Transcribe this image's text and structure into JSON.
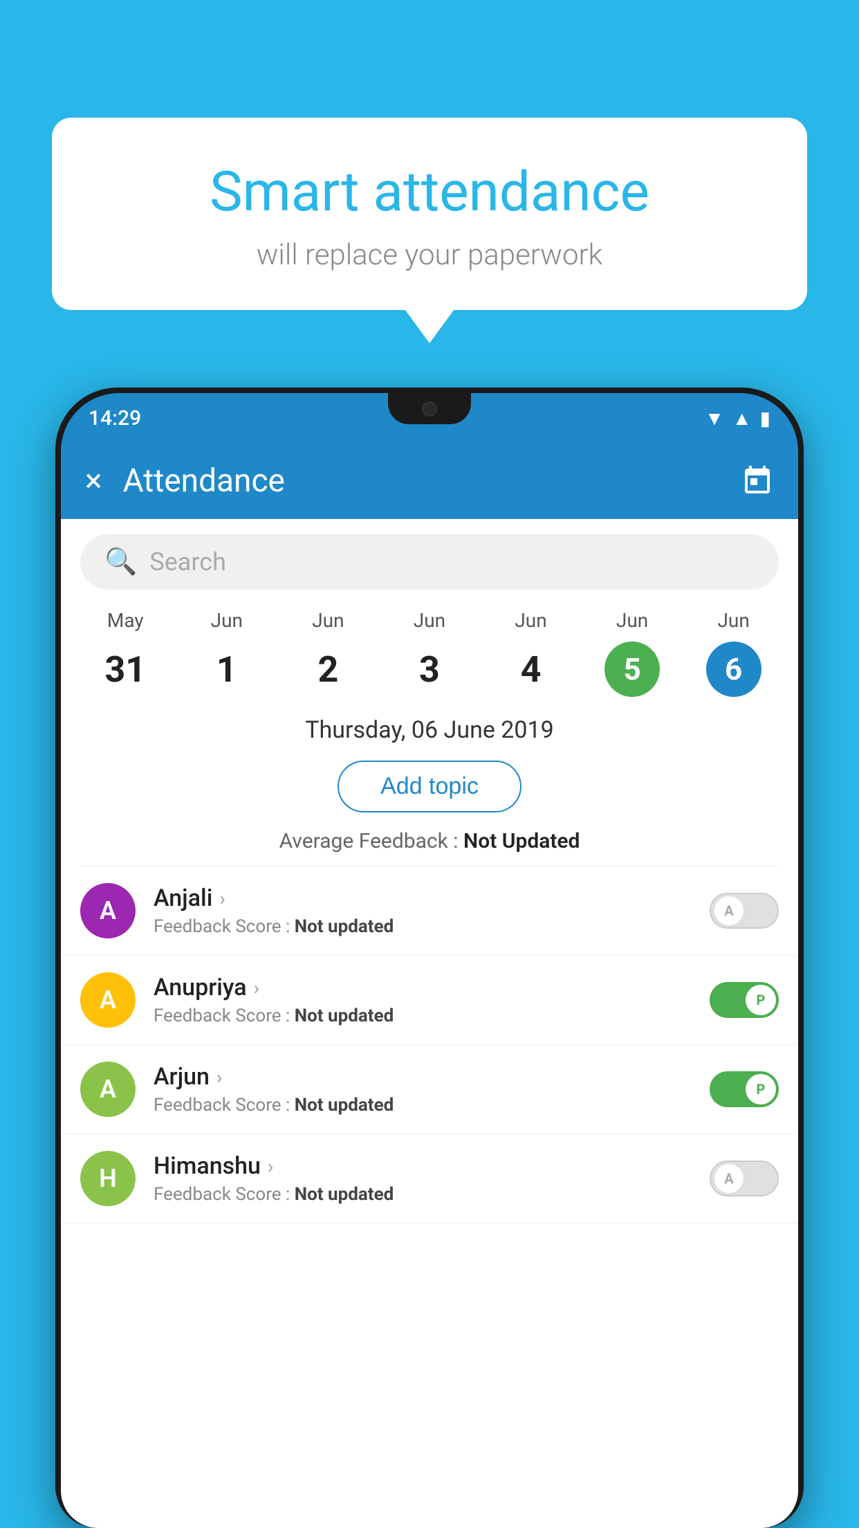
{
  "background_color": "#29b6e8",
  "speech_bubble": {
    "title": "Smart attendance",
    "subtitle": "will replace your paperwork"
  },
  "status_bar": {
    "time": "14:29",
    "icons": [
      "wifi",
      "signal",
      "battery"
    ]
  },
  "app_bar": {
    "title": "Attendance",
    "close_label": "×",
    "calendar_label": "📅"
  },
  "search": {
    "placeholder": "Search"
  },
  "calendar": {
    "days": [
      {
        "month": "May",
        "num": "31",
        "state": "normal"
      },
      {
        "month": "Jun",
        "num": "1",
        "state": "normal"
      },
      {
        "month": "Jun",
        "num": "2",
        "state": "normal"
      },
      {
        "month": "Jun",
        "num": "3",
        "state": "normal"
      },
      {
        "month": "Jun",
        "num": "4",
        "state": "normal"
      },
      {
        "month": "Jun",
        "num": "5",
        "state": "today"
      },
      {
        "month": "Jun",
        "num": "6",
        "state": "selected"
      }
    ]
  },
  "selected_date": "Thursday, 06 June 2019",
  "add_topic_label": "Add topic",
  "avg_feedback_label": "Average Feedback :",
  "avg_feedback_value": "Not Updated",
  "students": [
    {
      "name": "Anjali",
      "initial": "A",
      "avatar_color": "#9c27b0",
      "feedback_label": "Feedback Score :",
      "feedback_value": "Not updated",
      "toggle_state": "off",
      "toggle_label": "A"
    },
    {
      "name": "Anupriya",
      "initial": "A",
      "avatar_color": "#ffc107",
      "feedback_label": "Feedback Score :",
      "feedback_value": "Not updated",
      "toggle_state": "on",
      "toggle_label": "P"
    },
    {
      "name": "Arjun",
      "initial": "A",
      "avatar_color": "#8bc34a",
      "feedback_label": "Feedback Score :",
      "feedback_value": "Not updated",
      "toggle_state": "on",
      "toggle_label": "P"
    },
    {
      "name": "Himanshu",
      "initial": "H",
      "avatar_color": "#8bc34a",
      "feedback_label": "Feedback Score :",
      "feedback_value": "Not updated",
      "toggle_state": "off",
      "toggle_label": "A"
    }
  ]
}
